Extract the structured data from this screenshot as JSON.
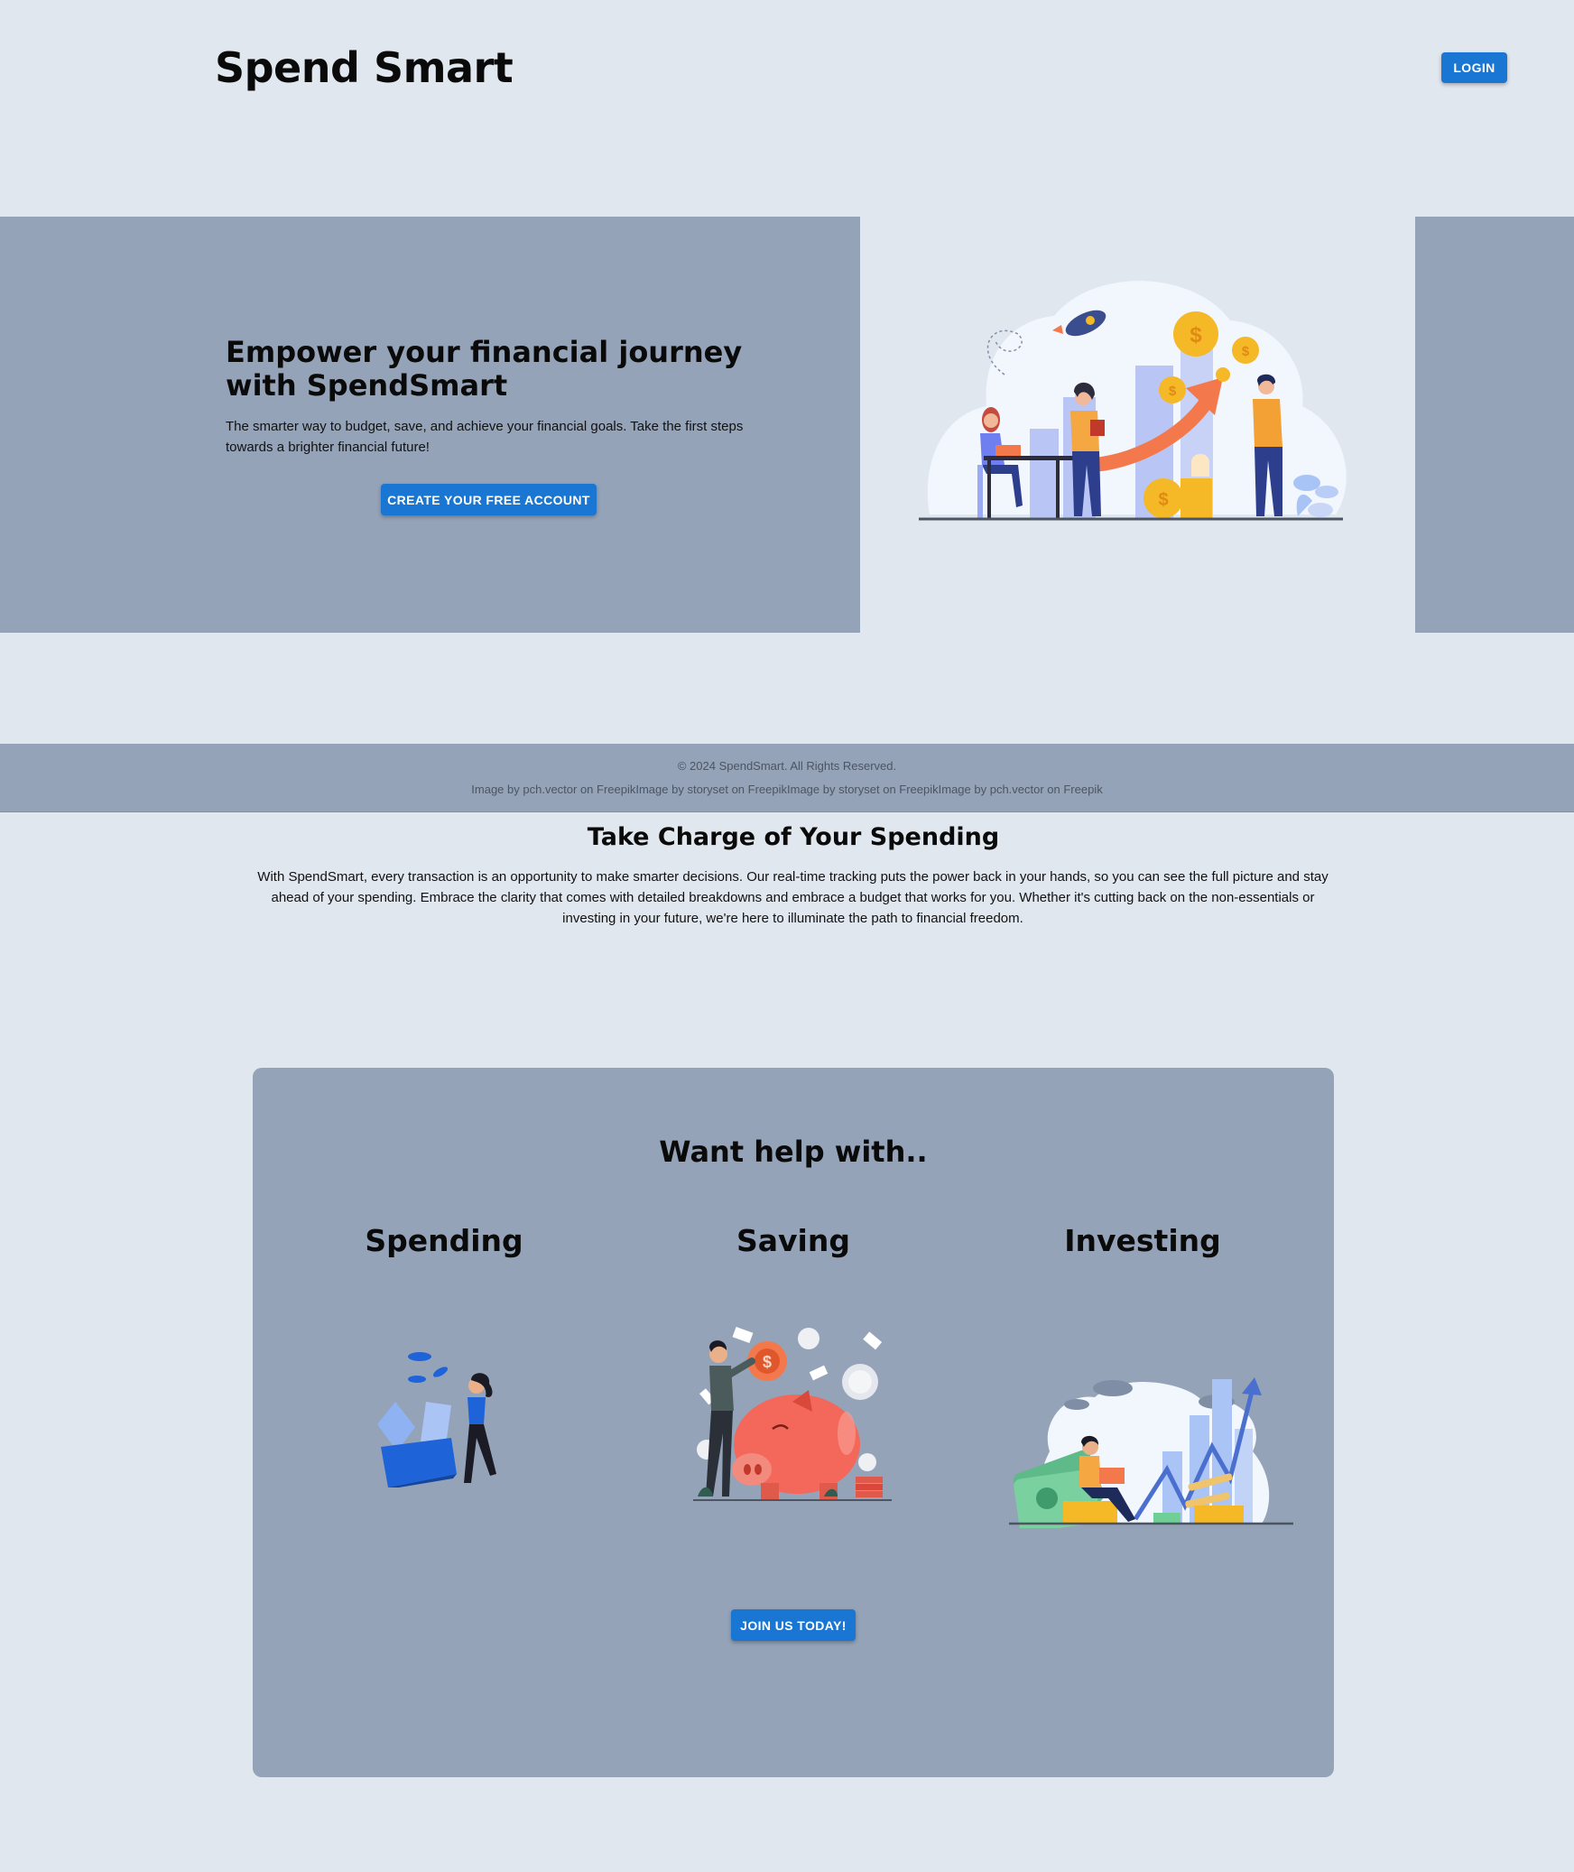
{
  "header": {
    "brand": "Spend Smart",
    "login_label": "LOGIN"
  },
  "hero": {
    "title": "Empower your financial journey with SpendSmart",
    "subtitle": "The smarter way to budget, save, and achieve your financial goals. Take the first steps towards a brighter financial future!",
    "cta_label": "CREATE YOUR FREE ACCOUNT"
  },
  "footer": {
    "copyright": "© 2024 SpendSmart. All Rights Reserved.",
    "credits": "Image by pch.vector on FreepikImage by storyset on FreepikImage by storyset on FreepikImage by pch.vector on Freepik"
  },
  "intro": {
    "title": "Take Charge of Your Spending",
    "body": "With SpendSmart, every transaction is an opportunity to make smarter decisions. Our real-time tracking puts the power back in your hands, so you can see the full picture and stay ahead of your spending. Embrace the clarity that comes with detailed breakdowns and embrace a budget that works for you. Whether it's cutting back on the non-essentials or investing in your future, we're here to illuminate the path to financial freedom."
  },
  "help": {
    "title": "Want help with..",
    "columns": [
      {
        "title": "Spending",
        "icon": "wallet-illustration-icon"
      },
      {
        "title": "Saving",
        "icon": "piggy-bank-illustration-icon"
      },
      {
        "title": "Investing",
        "icon": "investment-chart-illustration-icon"
      }
    ],
    "join_label": "JOIN US TODAY!"
  },
  "colors": {
    "background": "#e1e7ef",
    "panel": "#94a3b8",
    "primary_button": "#1976d2",
    "accent_orange": "#f3784b",
    "accent_gold": "#f5b826"
  }
}
